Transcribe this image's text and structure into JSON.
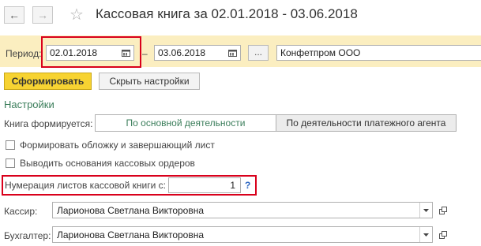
{
  "window": {
    "title": "Кассовая книга за 02.01.2018 - 03.06.2018",
    "back_icon": "←",
    "forward_icon": "→"
  },
  "period": {
    "label": "Период:",
    "from": "02.01.2018",
    "to": "03.06.2018",
    "dash": "–",
    "select_label": "...",
    "organization": "Конфетпром ООО"
  },
  "toolbar": {
    "generate_label": "Сформировать",
    "hide_settings_label": "Скрыть настройки"
  },
  "settings": {
    "heading": "Настройки",
    "book_formed_label": "Книга формируется:",
    "options": [
      "По основной деятельности",
      "По деятельности платежного агента"
    ],
    "selected_option": 0,
    "cover_checkbox_label": "Формировать обложку и завершающий лист",
    "cover_checked": false,
    "basis_checkbox_label": "Выводить основания кассовых ордеров",
    "basis_checked": false,
    "numbering_label": "Нумерация листов кассовой книги с:",
    "numbering_value": "1",
    "help_label": "?",
    "cashier_label": "Кассир:",
    "cashier_value": "Ларионова Светлана Викторовна",
    "accountant_label": "Бухгалтер:",
    "accountant_value": "Ларионова Светлана Викторовна"
  },
  "colors": {
    "period_band": "#fbeec0",
    "primary_button": "#f7d332",
    "accent_green": "#3a7d5a",
    "highlight_red": "#d9001b"
  }
}
